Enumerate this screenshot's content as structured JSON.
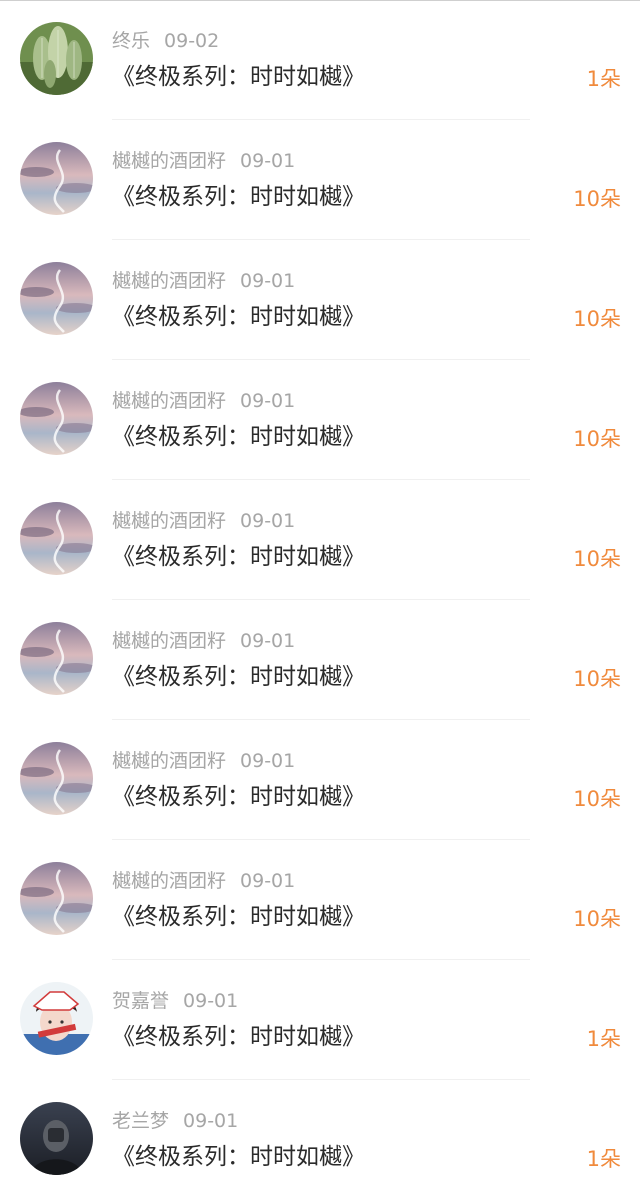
{
  "entries": [
    {
      "user": "终乐",
      "date": "09-02",
      "title": "《终极系列：时时如樾》",
      "count": "1朵",
      "avatar_icon": "cactus-avatar-icon"
    },
    {
      "user": "樾樾的酒团籽",
      "date": "09-01",
      "title": "《终极系列：时时如樾》",
      "count": "10朵",
      "avatar_icon": "sky-avatar-icon"
    },
    {
      "user": "樾樾的酒团籽",
      "date": "09-01",
      "title": "《终极系列：时时如樾》",
      "count": "10朵",
      "avatar_icon": "sky-avatar-icon"
    },
    {
      "user": "樾樾的酒团籽",
      "date": "09-01",
      "title": "《终极系列：时时如樾》",
      "count": "10朵",
      "avatar_icon": "sky-avatar-icon"
    },
    {
      "user": "樾樾的酒团籽",
      "date": "09-01",
      "title": "《终极系列：时时如樾》",
      "count": "10朵",
      "avatar_icon": "sky-avatar-icon"
    },
    {
      "user": "樾樾的酒团籽",
      "date": "09-01",
      "title": "《终极系列：时时如樾》",
      "count": "10朵",
      "avatar_icon": "sky-avatar-icon"
    },
    {
      "user": "樾樾的酒团籽",
      "date": "09-01",
      "title": "《终极系列：时时如樾》",
      "count": "10朵",
      "avatar_icon": "sky-avatar-icon"
    },
    {
      "user": "樾樾的酒团籽",
      "date": "09-01",
      "title": "《终极系列：时时如樾》",
      "count": "10朵",
      "avatar_icon": "sky-avatar-icon"
    },
    {
      "user": "贺嘉誉",
      "date": "09-01",
      "title": "《终极系列：时时如樾》",
      "count": "1朵",
      "avatar_icon": "girl-avatar-icon"
    },
    {
      "user": "老兰梦",
      "date": "09-01",
      "title": "《终极系列：时时如樾》",
      "count": "1朵",
      "avatar_icon": "dark-avatar-icon"
    }
  ],
  "colors": {
    "count": "#f08a3c",
    "meta": "#a6a6a6",
    "title": "#2b2b2b"
  }
}
